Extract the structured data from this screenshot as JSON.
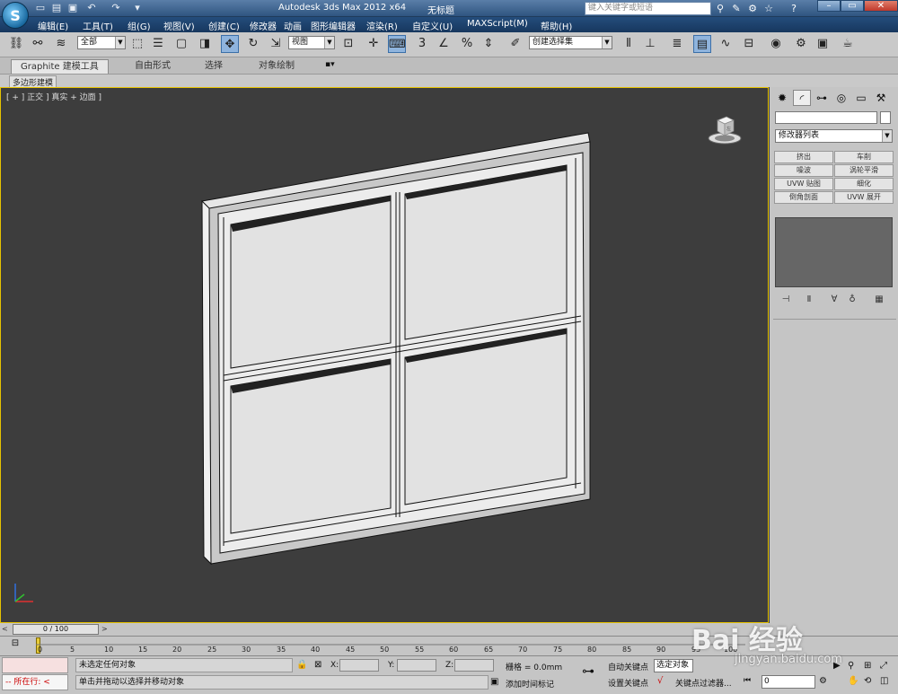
{
  "app": {
    "title": "Autodesk 3ds Max  2012 x64",
    "document": "无标题",
    "search_placeholder": "键入关键字或短语",
    "logo_glyph": "S"
  },
  "quick_access": [
    "new-icon",
    "open-icon",
    "save-icon",
    "undo-icon",
    "redo-icon",
    "dropdown-icon"
  ],
  "window_buttons": {
    "minimize": "–",
    "restore": "▭",
    "close": "✕"
  },
  "menus": [
    "编辑(E)",
    "工具(T)",
    "组(G)",
    "视图(V)",
    "创建(C)",
    "修改器",
    "动画",
    "图形编辑器",
    "渲染(R)",
    "自定义(U)",
    "MAXScript(M)",
    "帮助(H)"
  ],
  "toolbar": {
    "selection_filter": "全部",
    "ref_coord": "视图",
    "named_selection_placeholder": "创建选择集",
    "snap_label": "3",
    "percent_label": "%"
  },
  "ribbon": {
    "tabs": [
      "Graphite 建模工具",
      "自由形式",
      "选择",
      "对象绘制"
    ],
    "active_tab": "Graphite 建模工具",
    "sub_label": "多边形建模"
  },
  "viewport": {
    "label": "[ + ] 正交 ] 真实 + 边面 ]",
    "cube_face": "左"
  },
  "command_panel": {
    "modifier_list": "修改器列表",
    "modifier_buttons": [
      "挤出",
      "车削",
      "噪波",
      "涡轮平滑",
      "UVW 贴图",
      "细化",
      "倒角剖面",
      "UVW 展开"
    ]
  },
  "timeline": {
    "slider_text": "0 / 100",
    "ticks": [
      "0",
      "5",
      "10",
      "15",
      "20",
      "25",
      "30",
      "35",
      "40",
      "45",
      "50",
      "55",
      "60",
      "65",
      "70",
      "75",
      "80",
      "85",
      "90",
      "95",
      "100"
    ]
  },
  "status": {
    "maxscript": "--  所在行: <",
    "line1": "未选定任何对象",
    "line2": "单击并拖动以选择并移动对象",
    "x_label": "X:",
    "y_label": "Y:",
    "z_label": "Z:",
    "grid": "栅格 = 0.0mm",
    "add_time_tag": "添加时间标记",
    "auto_key": "自动关键点",
    "set_key": "设置关键点",
    "selection_set": "选定对象",
    "key_filters": "关键点过滤器...",
    "frame": "0"
  },
  "watermark": {
    "text": "Bai 经验",
    "url": "jingyan.baidu.com"
  }
}
